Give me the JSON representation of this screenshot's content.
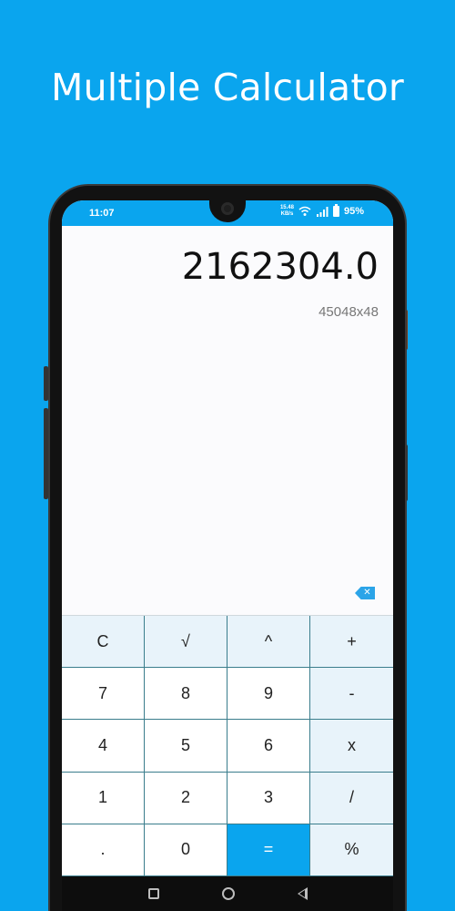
{
  "promo": {
    "title": "Multiple Calculator"
  },
  "statusbar": {
    "time": "11:07",
    "net_speed_value": "15.48",
    "net_speed_unit": "KB/s",
    "battery": "95%",
    "icons": [
      "wifi-icon",
      "signal-icon",
      "battery-icon"
    ]
  },
  "display": {
    "result": "2162304.0",
    "expression": "45048x48",
    "backspace_icon": "backspace-icon"
  },
  "keypad": {
    "keys": [
      {
        "label": "C",
        "type": "op"
      },
      {
        "label": "√",
        "type": "op"
      },
      {
        "label": "^",
        "type": "op"
      },
      {
        "label": "+",
        "type": "op"
      },
      {
        "label": "7",
        "type": "num"
      },
      {
        "label": "8",
        "type": "num"
      },
      {
        "label": "9",
        "type": "num"
      },
      {
        "label": "-",
        "type": "op"
      },
      {
        "label": "4",
        "type": "num"
      },
      {
        "label": "5",
        "type": "num"
      },
      {
        "label": "6",
        "type": "num"
      },
      {
        "label": "x",
        "type": "op"
      },
      {
        "label": "1",
        "type": "num"
      },
      {
        "label": "2",
        "type": "num"
      },
      {
        "label": "3",
        "type": "num"
      },
      {
        "label": "/",
        "type": "op"
      },
      {
        "label": ".",
        "type": "num"
      },
      {
        "label": "0",
        "type": "num"
      },
      {
        "label": "=",
        "type": "eq"
      },
      {
        "label": "%",
        "type": "op"
      }
    ]
  },
  "colors": {
    "accent": "#0aa5ee",
    "op_key_bg": "#e8f3fa",
    "grid_line": "#3a7d8c"
  },
  "navbar": {
    "icons": [
      "recents-icon",
      "home-icon",
      "back-icon"
    ]
  }
}
